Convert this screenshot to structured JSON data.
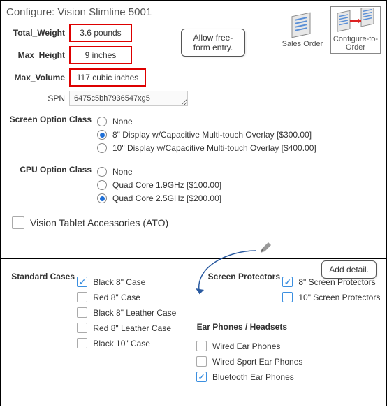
{
  "title": "Configure: Vision Slimline 5001",
  "fields": {
    "total_weight_label": "Total_Weight",
    "total_weight_value": "3.6 pounds",
    "max_height_label": "Max_Height",
    "max_height_value": "9 inches",
    "max_volume_label": "Max_Volume",
    "max_volume_value": "117 cubic inches",
    "spn_label": "SPN",
    "spn_value": "6475c5bh7936547xg5"
  },
  "callouts": {
    "freeform": "Allow free-form entry.",
    "add_detail": "Add detail."
  },
  "icons": {
    "sales_order": "Sales Order",
    "cto": "Configure-to-Order"
  },
  "screen_option": {
    "label": "Screen Option Class",
    "options": [
      {
        "label": "None",
        "selected": false
      },
      {
        "label": "8\" Display w/Capacitive Multi-touch Overlay [$300.00]",
        "selected": true
      },
      {
        "label": "10\" Display w/Capacitive Multi-touch Overlay [$400.00]",
        "selected": false
      }
    ]
  },
  "cpu_option": {
    "label": "CPU Option Class",
    "options": [
      {
        "label": "None",
        "selected": false
      },
      {
        "label": "Quad Core 1.9GHz [$100.00]",
        "selected": false
      },
      {
        "label": "Quad Core 2.5GHz [$200.00]",
        "selected": true
      }
    ]
  },
  "ato_label": "Vision Tablet Accessories (ATO)",
  "accessories": {
    "standard_cases": {
      "label": "Standard Cases",
      "items": [
        {
          "label": "Black 8\" Case",
          "checked": true
        },
        {
          "label": "Red 8\" Case",
          "checked": false
        },
        {
          "label": "Black 8\" Leather Case",
          "checked": false
        },
        {
          "label": "Red 8\" Leather Case",
          "checked": false
        },
        {
          "label": "Black 10\" Case",
          "checked": false
        }
      ]
    },
    "screen_protectors": {
      "label": "Screen Protectors",
      "items": [
        {
          "label": "8\" Screen Protectors",
          "checked": true
        },
        {
          "label": "10\" Screen Protectors",
          "checked": false
        }
      ]
    },
    "ear_phones": {
      "label": "Ear Phones / Headsets",
      "items": [
        {
          "label": "Wired Ear Phones",
          "checked": false
        },
        {
          "label": "Wired Sport Ear Phones",
          "checked": false
        },
        {
          "label": "Bluetooth Ear Phones",
          "checked": true
        }
      ]
    }
  }
}
